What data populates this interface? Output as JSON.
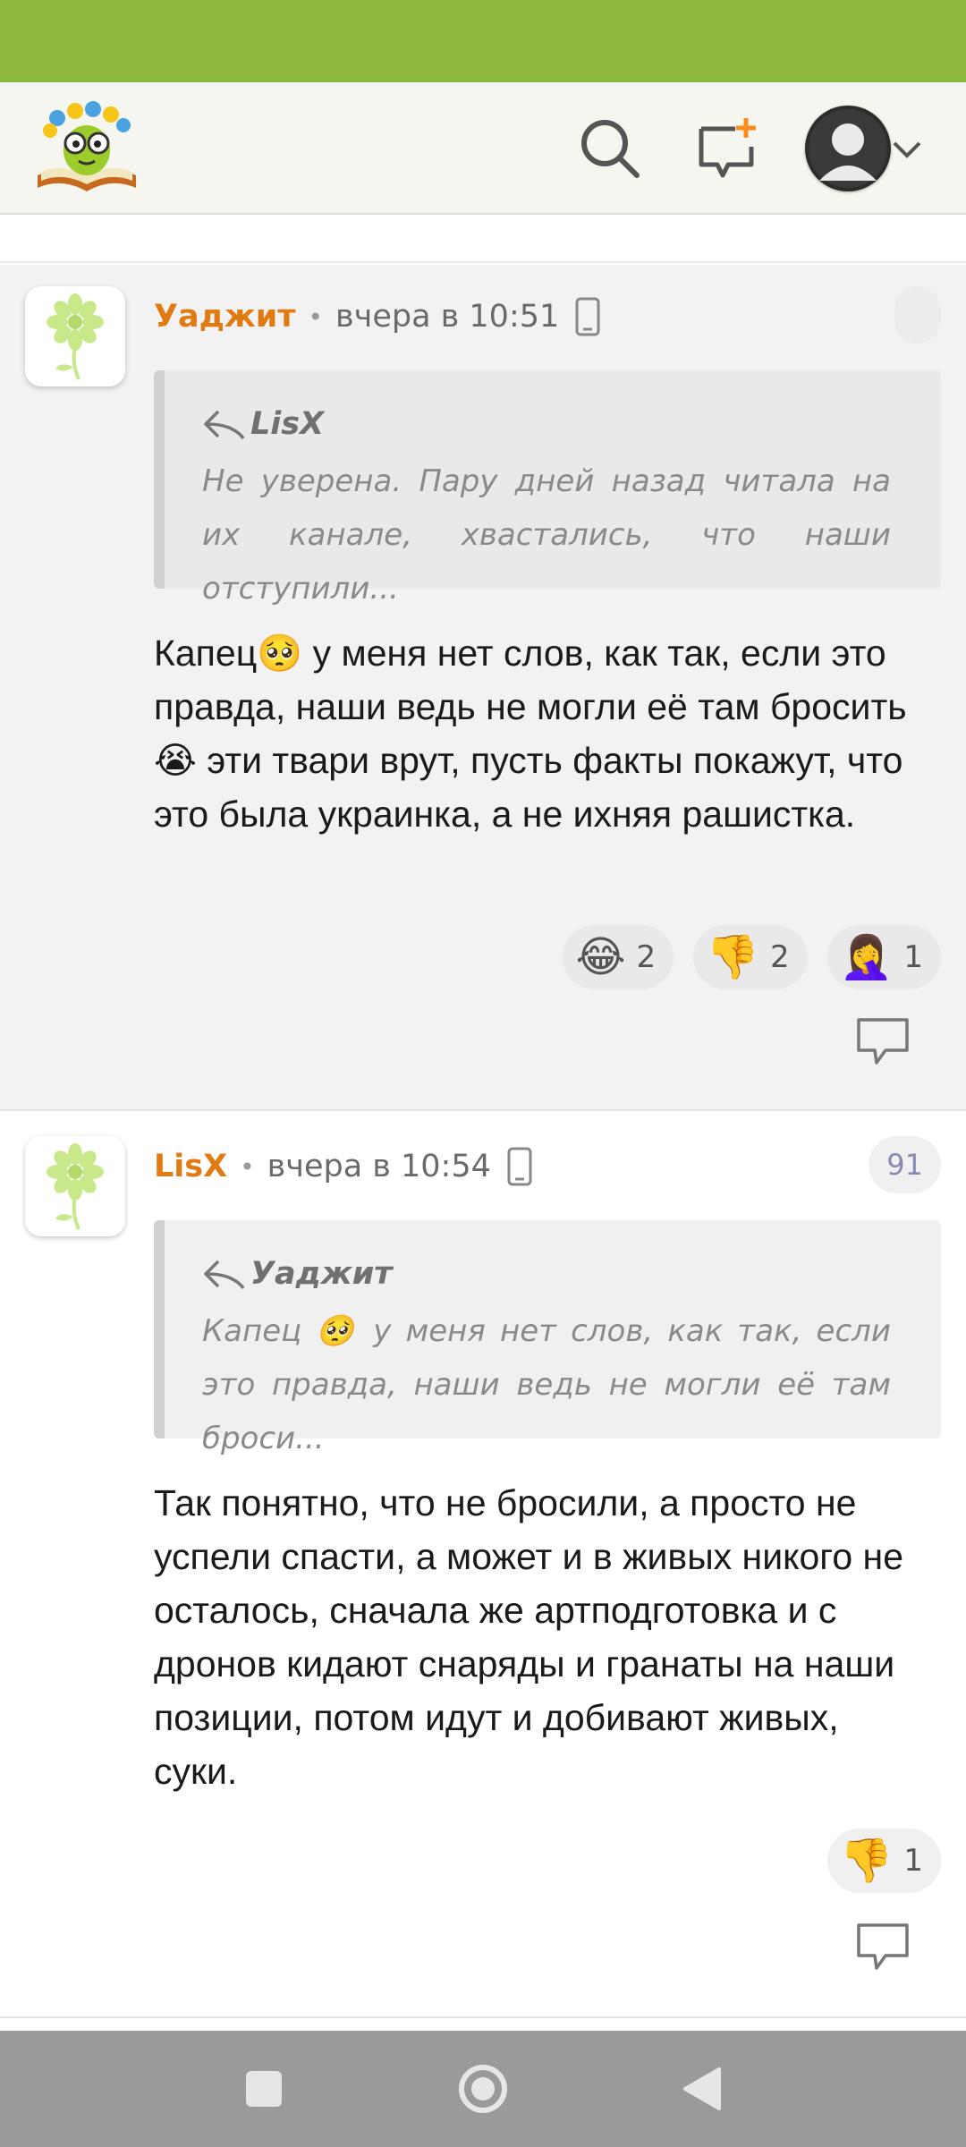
{
  "header": {
    "logo_name": "site-logo",
    "icons": [
      "search-icon",
      "new-message-icon",
      "user-avatar-icon",
      "chevron-down-icon"
    ]
  },
  "comments": [
    {
      "username": "Уаджит",
      "time": "вчера в 10:51",
      "counter": "",
      "quote": {
        "author": "LisX",
        "text": "Не уверена. Пару дней назад читала на их канале, хвастались, что наши отступили..."
      },
      "body": "Капец🥺 у меня нет слов, как так, если это правда, наши ведь не могли её там бросить😭 эти твари врут, пусть факты покажут, что это была украинка, а не ихняя рашистка.",
      "reactions": [
        {
          "emoji": "😂",
          "count": "2"
        },
        {
          "emoji": "👎",
          "count": "2"
        },
        {
          "emoji": "🤦‍♀️",
          "count": "1"
        }
      ]
    },
    {
      "username": "LisX",
      "time": "вчера в 10:54",
      "counter": "91",
      "quote": {
        "author": "Уаджит",
        "text": "Капец 🥺 у меня нет слов, как так, если это правда, наши ведь не могли её там броси..."
      },
      "body": "Так понятно, что не бросили, а просто не успели спасти, а может и в живых никого не осталось, сначала же артподготовка и с дронов кидают снаряды и гранаты на наши позиции, потом идут и добивают живых, суки.",
      "reactions": [
        {
          "emoji": "👎",
          "count": "1"
        }
      ]
    }
  ],
  "colors": {
    "status_bar": "#8db83e",
    "username": "#e27a12",
    "header_bg": "#f6f6f1",
    "nav_bar": "#9a9a9a"
  }
}
